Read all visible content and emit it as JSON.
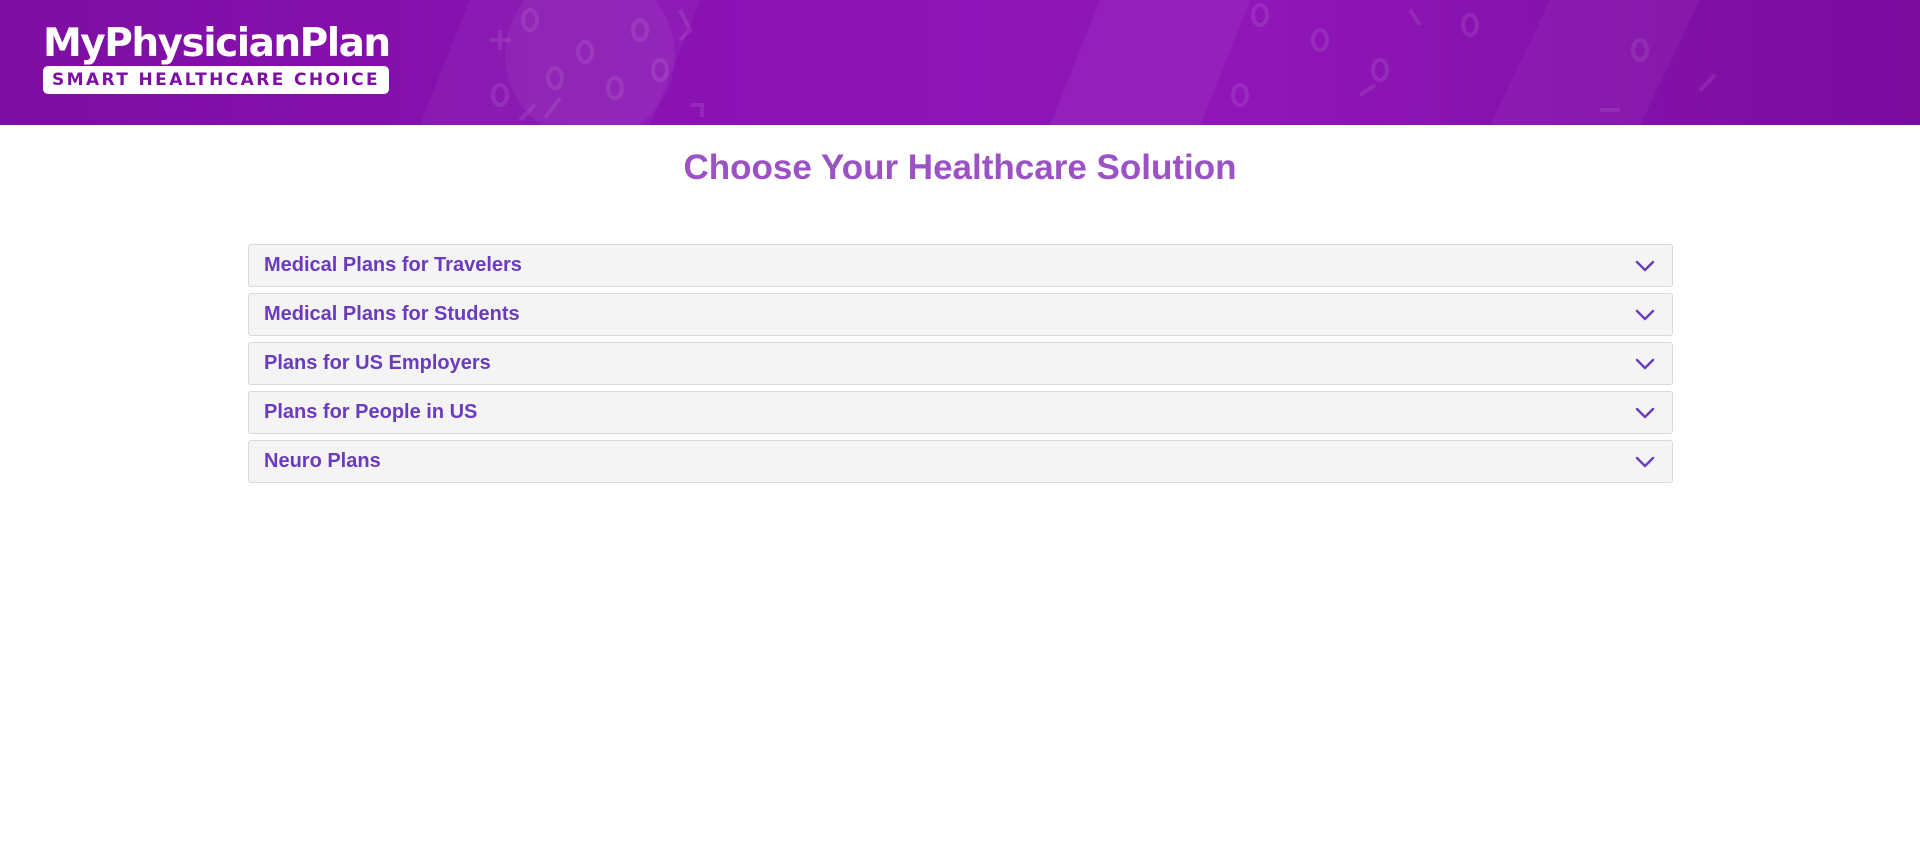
{
  "header": {
    "logo_title": "MyPhysicianPlan",
    "logo_tagline": "SMART HEALTHCARE CHOICE",
    "background_color": "#8a12b3"
  },
  "main": {
    "title": "Choose Your Healthcare Solution",
    "title_color": "#9b52c4",
    "accordion": [
      {
        "label": "Medical Plans for Travelers",
        "icon": "chevron-down-icon"
      },
      {
        "label": "Medical Plans for Students",
        "icon": "chevron-down-icon"
      },
      {
        "label": "Plans for US Employers",
        "icon": "chevron-down-icon"
      },
      {
        "label": "Plans for People in US",
        "icon": "chevron-down-icon"
      },
      {
        "label": "Neuro Plans",
        "icon": "chevron-down-icon"
      }
    ],
    "accordion_label_color": "#6a3bbd"
  }
}
